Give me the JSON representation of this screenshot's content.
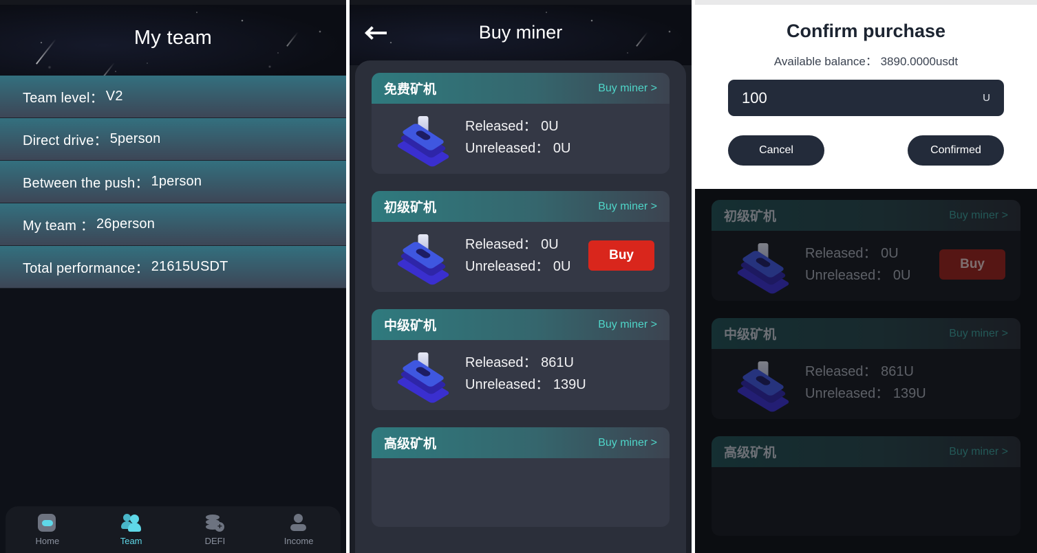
{
  "left_panel": {
    "title": "My team",
    "stats": [
      {
        "label": "Team level：",
        "value": "V2"
      },
      {
        "label": "Direct drive：",
        "value": "5person"
      },
      {
        "label": "Between the push：",
        "value": "1person"
      },
      {
        "label": "My team ：",
        "value": "26person"
      },
      {
        "label": "Total performance：",
        "value": "21615USDT"
      }
    ],
    "bottom_nav": [
      {
        "label": "Home",
        "icon": "home-icon",
        "active": false
      },
      {
        "label": "Team",
        "icon": "team-icon",
        "active": true
      },
      {
        "label": "DEFI",
        "icon": "defi-coins-icon",
        "active": false
      },
      {
        "label": "Income",
        "icon": "person-icon",
        "active": false
      }
    ]
  },
  "mid_panel": {
    "back_icon": "back-arrow-icon",
    "title": "Buy miner",
    "miners": [
      {
        "name": "免费矿机",
        "link": "Buy miner >",
        "released_label": "Released：",
        "released_value": "0U",
        "unreleased_label": "Unreleased：",
        "unreleased_value": "0U",
        "buy_label": "",
        "has_buy": false
      },
      {
        "name": "初级矿机",
        "link": "Buy miner >",
        "released_label": "Released：",
        "released_value": "0U",
        "unreleased_label": "Unreleased：",
        "unreleased_value": "0U",
        "buy_label": "Buy",
        "has_buy": true
      },
      {
        "name": "中级矿机",
        "link": "Buy miner >",
        "released_label": "Released：",
        "released_value": "861U",
        "unreleased_label": "Unreleased：",
        "unreleased_value": "139U",
        "buy_label": "",
        "has_buy": false
      },
      {
        "name": "高级矿机",
        "link": "Buy miner >",
        "released_label": "",
        "released_value": "",
        "unreleased_label": "",
        "unreleased_value": "",
        "buy_label": "",
        "has_buy": false
      }
    ]
  },
  "right_panel": {
    "dialog": {
      "title": "Confirm purchase",
      "balance_label": "Available balance：",
      "balance_value": "3890.0000usdt",
      "amount_value": "100",
      "amount_unit": "U",
      "cancel_label": "Cancel",
      "confirm_label": "Confirmed"
    },
    "miners": [
      {
        "name": "初级矿机",
        "link": "Buy miner >",
        "released_label": "Released：",
        "released_value": "0U",
        "unreleased_label": "Unreleased：",
        "unreleased_value": "0U",
        "buy_label": "Buy",
        "has_buy": true
      },
      {
        "name": "中级矿机",
        "link": "Buy miner >",
        "released_label": "Released：",
        "released_value": "861U",
        "unreleased_label": "Unreleased：",
        "unreleased_value": "139U",
        "buy_label": "",
        "has_buy": false
      },
      {
        "name": "高级矿机",
        "link": "Buy miner >",
        "released_label": "",
        "released_value": "",
        "unreleased_label": "",
        "unreleased_value": "",
        "buy_label": "",
        "has_buy": false
      }
    ]
  },
  "colors": {
    "accent_teal": "#4fd5c8",
    "buy_red": "#d9261c",
    "nav_active": "#5fd8e8",
    "row_gradient_top": "#33707f",
    "row_gradient_bottom": "#3d4656"
  }
}
